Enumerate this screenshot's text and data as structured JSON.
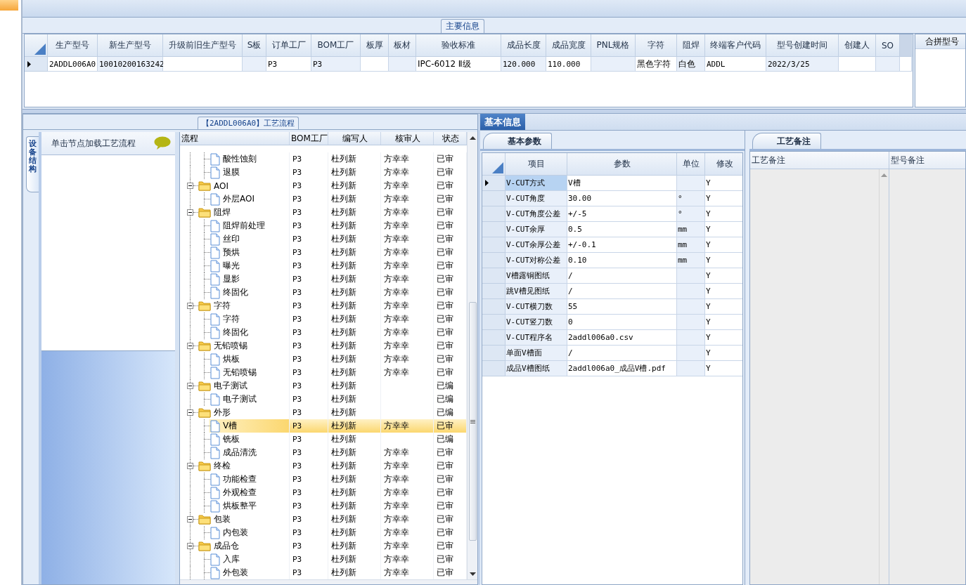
{
  "main_info": {
    "title": "主要信息",
    "columns": [
      "生产型号",
      "新生产型号",
      "升级前旧生产型号",
      "S板",
      "订单工厂",
      "BOM工厂",
      "板厚",
      "板材",
      "验收标准",
      "成品长度",
      "成品宽度",
      "PNL规格",
      "字符",
      "阻焊",
      "终端客户代码",
      "型号创建时间",
      "创建人",
      "SO"
    ],
    "rows": [
      {
        "selected": true,
        "cells": [
          "2ADDL006A0",
          "10010200163242",
          null,
          null,
          "P3",
          "P3",
          null,
          null,
          "IPC-6012 Ⅱ级",
          "120.000",
          "110.000",
          null,
          "黑色字符",
          "白色",
          "ADDL",
          "2022/3/25",
          null,
          null
        ]
      }
    ]
  },
  "merge_panel": {
    "title": "合拼型号"
  },
  "process": {
    "title": "【2ADDL006A0】工艺流程",
    "side_tab": "设备结构",
    "hint": "单击节点加载工艺流程",
    "columns": [
      "流程",
      "BOM工厂",
      "编写人",
      "核审人",
      "状态"
    ],
    "nodes": [
      {
        "kind": "file",
        "name": "酸性蚀刻",
        "bom": "P3",
        "writer": "杜列新",
        "reviewer": "方幸幸",
        "status": "已审",
        "selected": false
      },
      {
        "kind": "file",
        "name": "退膜",
        "bom": "P3",
        "writer": "杜列新",
        "reviewer": "方幸幸",
        "status": "已审",
        "selected": false
      },
      {
        "kind": "folder",
        "name": "AOI",
        "bom": "P3",
        "writer": "杜列新",
        "reviewer": "方幸幸",
        "status": "已审",
        "selected": false,
        "expanded": true,
        "children": [
          {
            "kind": "file",
            "name": "外层AOI",
            "bom": "P3",
            "writer": "杜列新",
            "reviewer": "方幸幸",
            "status": "已审",
            "selected": false
          }
        ]
      },
      {
        "kind": "folder",
        "name": "阻焊",
        "bom": "P3",
        "writer": "杜列新",
        "reviewer": "方幸幸",
        "status": "已审",
        "selected": false,
        "expanded": true,
        "children": [
          {
            "kind": "file",
            "name": "阻焊前处理",
            "bom": "P3",
            "writer": "杜列新",
            "reviewer": "方幸幸",
            "status": "已审",
            "selected": false
          },
          {
            "kind": "file",
            "name": "丝印",
            "bom": "P3",
            "writer": "杜列新",
            "reviewer": "方幸幸",
            "status": "已审",
            "selected": false
          },
          {
            "kind": "file",
            "name": "预烘",
            "bom": "P3",
            "writer": "杜列新",
            "reviewer": "方幸幸",
            "status": "已审",
            "selected": false
          },
          {
            "kind": "file",
            "name": "曝光",
            "bom": "P3",
            "writer": "杜列新",
            "reviewer": "方幸幸",
            "status": "已审",
            "selected": false
          },
          {
            "kind": "file",
            "name": "显影",
            "bom": "P3",
            "writer": "杜列新",
            "reviewer": "方幸幸",
            "status": "已审",
            "selected": false
          },
          {
            "kind": "file",
            "name": "终固化",
            "bom": "P3",
            "writer": "杜列新",
            "reviewer": "方幸幸",
            "status": "已审",
            "selected": false
          }
        ]
      },
      {
        "kind": "folder",
        "name": "字符",
        "bom": "P3",
        "writer": "杜列新",
        "reviewer": "方幸幸",
        "status": "已审",
        "selected": false,
        "expanded": true,
        "children": [
          {
            "kind": "file",
            "name": "字符",
            "bom": "P3",
            "writer": "杜列新",
            "reviewer": "方幸幸",
            "status": "已审",
            "selected": false
          },
          {
            "kind": "file",
            "name": "终固化",
            "bom": "P3",
            "writer": "杜列新",
            "reviewer": "方幸幸",
            "status": "已审",
            "selected": false
          }
        ]
      },
      {
        "kind": "folder",
        "name": "无铅喷锡",
        "bom": "P3",
        "writer": "杜列新",
        "reviewer": "方幸幸",
        "status": "已审",
        "selected": false,
        "expanded": true,
        "children": [
          {
            "kind": "file",
            "name": "烘板",
            "bom": "P3",
            "writer": "杜列新",
            "reviewer": "方幸幸",
            "status": "已审",
            "selected": false
          },
          {
            "kind": "file",
            "name": "无铅喷锡",
            "bom": "P3",
            "writer": "杜列新",
            "reviewer": "方幸幸",
            "status": "已审",
            "selected": false
          }
        ]
      },
      {
        "kind": "folder",
        "name": "电子测试",
        "bom": "P3",
        "writer": "杜列新",
        "status": "已编",
        "selected": false,
        "expanded": true,
        "children": [
          {
            "kind": "file",
            "name": "电子测试",
            "bom": "P3",
            "writer": "杜列新",
            "status": "已编",
            "selected": false
          }
        ]
      },
      {
        "kind": "folder",
        "name": "外形",
        "bom": "P3",
        "writer": "杜列新",
        "status": "已编",
        "selected": false,
        "expanded": true,
        "children": [
          {
            "kind": "file",
            "name": "V槽",
            "bom": "P3",
            "writer": "杜列新",
            "reviewer": "方幸幸",
            "status": "已审",
            "selected": true
          },
          {
            "kind": "file",
            "name": "铣板",
            "bom": "P3",
            "writer": "杜列新",
            "status": "已编",
            "selected": false
          },
          {
            "kind": "file",
            "name": "成品清洗",
            "bom": "P3",
            "writer": "杜列新",
            "reviewer": "方幸幸",
            "status": "已审",
            "selected": false
          }
        ]
      },
      {
        "kind": "folder",
        "name": "终检",
        "bom": "P3",
        "writer": "杜列新",
        "reviewer": "方幸幸",
        "status": "已审",
        "selected": false,
        "expanded": true,
        "children": [
          {
            "kind": "file",
            "name": "功能检查",
            "bom": "P3",
            "writer": "杜列新",
            "reviewer": "方幸幸",
            "status": "已审",
            "selected": false
          },
          {
            "kind": "file",
            "name": "外观检查",
            "bom": "P3",
            "writer": "杜列新",
            "reviewer": "方幸幸",
            "status": "已审",
            "selected": false
          },
          {
            "kind": "file",
            "name": "烘板整平",
            "bom": "P3",
            "writer": "杜列新",
            "reviewer": "方幸幸",
            "status": "已审",
            "selected": false
          }
        ]
      },
      {
        "kind": "folder",
        "name": "包装",
        "bom": "P3",
        "writer": "杜列新",
        "reviewer": "方幸幸",
        "status": "已审",
        "selected": false,
        "expanded": true,
        "children": [
          {
            "kind": "file",
            "name": "内包装",
            "bom": "P3",
            "writer": "杜列新",
            "reviewer": "方幸幸",
            "status": "已审",
            "selected": false
          }
        ]
      },
      {
        "kind": "folder",
        "name": "成品仓",
        "bom": "P3",
        "writer": "杜列新",
        "reviewer": "方幸幸",
        "status": "已审",
        "selected": false,
        "expanded": true,
        "children": [
          {
            "kind": "file",
            "name": "入库",
            "bom": "P3",
            "writer": "杜列新",
            "reviewer": "方幸幸",
            "status": "已审",
            "selected": false
          },
          {
            "kind": "file",
            "name": "外包装",
            "bom": "P3",
            "writer": "杜列新",
            "reviewer": "方幸幸",
            "status": "已审",
            "selected": false
          }
        ]
      }
    ]
  },
  "basic_info": {
    "tab": "基本信息",
    "params_tab": "基本参数",
    "columns": [
      "项目",
      "参数",
      "单位",
      "修改"
    ],
    "rows": [
      {
        "item": "V-CUT方式",
        "value": "V槽",
        "modified": "Y",
        "selected": true
      },
      {
        "item": "V-CUT角度",
        "value": "30.00",
        "unit": "°",
        "modified": "Y",
        "selected": false
      },
      {
        "item": "V-CUT角度公差",
        "value": "+/-5",
        "unit": "°",
        "modified": "Y",
        "selected": false
      },
      {
        "item": "V-CUT余厚",
        "value": "0.5",
        "unit": "mm",
        "modified": "Y",
        "selected": false
      },
      {
        "item": "V-CUT余厚公差",
        "value": "+/-0.1",
        "unit": "mm",
        "modified": "Y",
        "selected": false
      },
      {
        "item": "V-CUT对称公差",
        "value": "0.10",
        "unit": "mm",
        "modified": "Y",
        "selected": false
      },
      {
        "item": "V槽露铜图纸",
        "value": "/",
        "modified": "Y",
        "selected": false
      },
      {
        "item": "跳V槽见图纸",
        "value": "/",
        "modified": "Y",
        "selected": false
      },
      {
        "item": "V-CUT横刀数",
        "value": "55",
        "modified": "Y",
        "selected": false
      },
      {
        "item": "V-CUT竖刀数",
        "value": "0",
        "modified": "Y",
        "selected": false
      },
      {
        "item": "V-CUT程序名",
        "value": "2addl006a0.csv",
        "modified": "Y",
        "selected": false
      },
      {
        "item": "单面V槽面",
        "value": "/",
        "modified": "Y",
        "selected": false
      },
      {
        "item": "成品V槽图纸",
        "value": "2addl006a0_成品V槽.pdf",
        "modified": "Y",
        "selected": false
      }
    ]
  },
  "notes": {
    "tab": "工艺备注",
    "columns": [
      "工艺备注",
      "型号备注"
    ]
  }
}
